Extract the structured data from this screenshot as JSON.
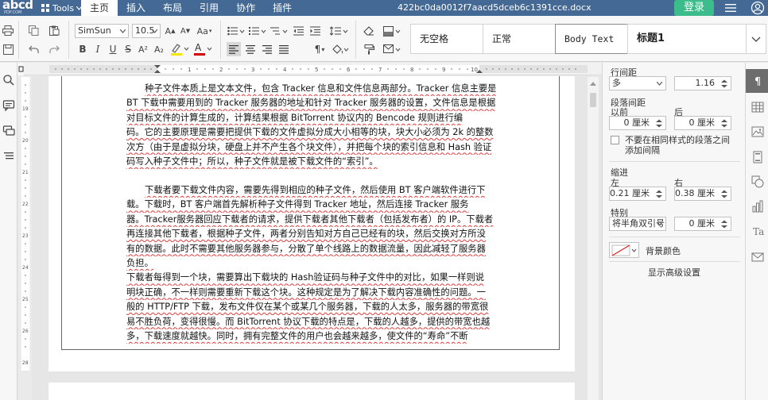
{
  "app": {
    "logo_text": "abcd",
    "logo_sub": "PDF.COM",
    "tools_label": "Tools",
    "document_title": "422bc0da0012f7aacd5dceb6c1391cce.docx",
    "login_label": "登录"
  },
  "menu": {
    "items": [
      {
        "label": "主页",
        "active": true
      },
      {
        "label": "插入",
        "active": false
      },
      {
        "label": "布局",
        "active": false
      },
      {
        "label": "引用",
        "active": false
      },
      {
        "label": "协作",
        "active": false
      },
      {
        "label": "插件",
        "active": false
      }
    ]
  },
  "toolbar": {
    "font_name": "SimSun",
    "font_size": "10.5",
    "bold_label": "B",
    "italic_label": "I",
    "underline_label": "U",
    "strike_label": "S",
    "superscript_label": "A²",
    "subscript_label": "A₂",
    "grow_font_label": "A",
    "shrink_font_label": "A",
    "case_label": "Aa",
    "font_color_label": "A",
    "highlight_color": "#f5e800",
    "font_color": "#d20000",
    "styles": [
      {
        "label": "无空格",
        "selected": false
      },
      {
        "label": "正常",
        "selected": false
      },
      {
        "label": "Body Text",
        "selected": true
      },
      {
        "label": "标题1",
        "selected": false
      }
    ]
  },
  "document": {
    "paragraphs": [
      {
        "lines": [
          {
            "text": "种子文件本质上是文本文件，包含 Tracker 信息和文件信息两部分。Tracker 信息主要是",
            "indent": true
          },
          {
            "text": "BT 下载中需要用到的 Tracker 服务器的地址和针对 Tracker 服务器的设置，文件信息是根据",
            "indent": false
          },
          {
            "text": "对目标文件的计算生成的，计算结果根据 BitTorrent 协议内的 Bencode 规则进行编",
            "indent": false
          },
          {
            "text": "码。它的主要原理是需要把提供下载的文件虚拟分成大小相等的块，块大小必须为 2k 的整数",
            "indent": false
          },
          {
            "text": "次方（由于是虚拟分块，硬盘上并不产生各个块文件），并把每个块的索引信息和 Hash 验证",
            "indent": false
          },
          {
            "text": "码写入种子文件中；所以，种子文件就是被下载文件的“索引”。",
            "indent": false
          }
        ]
      },
      {
        "lines": [
          {
            "text": "下载者要下载文件内容，需要先得到相应的种子文件，然后使用 BT 客户端软件进行下",
            "indent": true
          },
          {
            "text": "载。下载时，BT 客户端首先解析种子文件得到 Tracker 地址，然后连接 Tracker 服务",
            "indent": false
          },
          {
            "text": "器。Tracker服务器回应下载者的请求，提供下载者其他下载者（包括发布者）的 IP。下载者",
            "indent": false
          },
          {
            "text": "再连接其他下载者，根据种子文件，两者分别告知对方自己已经有的块，然后交换对方所没",
            "indent": false
          },
          {
            "text": "有的数据。此时不需要其他服务器参与，分散了单个线路上的数据流量，因此减轻了服务器",
            "indent": false
          },
          {
            "text": "负担。",
            "indent": false
          },
          {
            "text": "下载者每得到一个块，需要算出下载块的 Hash验证码与种子文件中的对比，如果一样则说",
            "indent": false
          },
          {
            "text": "明块正确，不一样则需要重新下载这个块。这种规定是为了解决下载内容准确性的问题。一",
            "indent": false
          },
          {
            "text": "般的 HTTP/FTP 下载，发布文件仅在某个或某几个服务器，下载的人太多，服务器的带宽很",
            "indent": false
          },
          {
            "text": "易不胜负荷，变得很慢。而 BitTorrent 协议下载的特点是，下载的人越多，提供的带宽也越",
            "indent": false
          },
          {
            "text": "多，下载速度就越快。同时，拥有完整文件的用户也会越来越多，使文件的“寿命”不断",
            "indent": false
          }
        ]
      }
    ]
  },
  "paragraph_panel": {
    "line_spacing_label": "行间距",
    "line_spacing_type": "多",
    "line_spacing_value": "1.16",
    "para_spacing_label": "段落间距",
    "before_label": "以前",
    "after_label": "后",
    "before_value": "0 厘米",
    "after_value": "0 厘米",
    "no_space_same_style": "不要在相同样式的段落之间添加间隔",
    "indent_label": "缩进",
    "left_label": "左",
    "right_label": "右",
    "left_value": "0.21 厘米",
    "right_value": "0.38 厘米",
    "special_label": "特别",
    "special_type": "将半角双引号",
    "special_value": "0 厘米",
    "background_color_label": "背景颜色",
    "advanced_settings_label": "显示高级设置"
  },
  "colors": {
    "header_bg": "#446995",
    "login_bg": "#3bbc8a",
    "spellcheck_underline": "#e53939"
  }
}
